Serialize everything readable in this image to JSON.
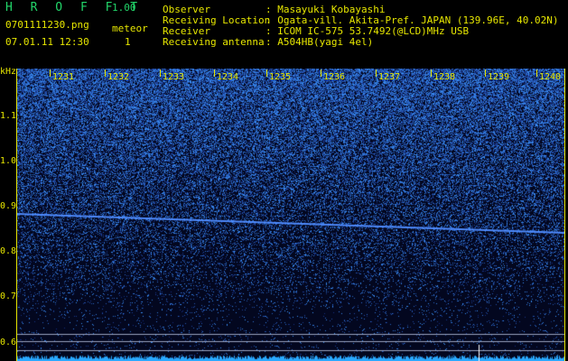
{
  "app": {
    "logo": "H R O F F T",
    "version": "1.00",
    "filename": "0701111230.png",
    "datetime": "07.01.11 12:30",
    "meteor_label": "meteor",
    "meteor_count": "1"
  },
  "info": {
    "observer_label": "Observer",
    "observer_value": ": Masayuki Kobayashi",
    "location_label": "Receiving Location",
    "location_value": ": Ogata-vill. Akita-Pref. JAPAN (139.96E, 40.02N)",
    "receiver_label": "Receiver",
    "receiver_value": ": ICOM IC-575 53.7492(@LCD)MHz USB",
    "antenna_label": "Receiving antenna",
    "antenna_value": ": A504HB(yagi 4el)"
  },
  "axes": {
    "y_unit": "kHz",
    "y_ticks": [
      "1.1",
      "1.0",
      "0.9",
      "0.8",
      "0.7",
      "0.6"
    ],
    "x_ticks": [
      "1231",
      "1232",
      "1233",
      "1234",
      "1235",
      "1236",
      "1237",
      "1238",
      "1239",
      "1240"
    ]
  },
  "colors": {
    "label": "#e6e600",
    "logo": "#22d66a",
    "background": "#03071f",
    "signal": "#3a7bff"
  }
}
